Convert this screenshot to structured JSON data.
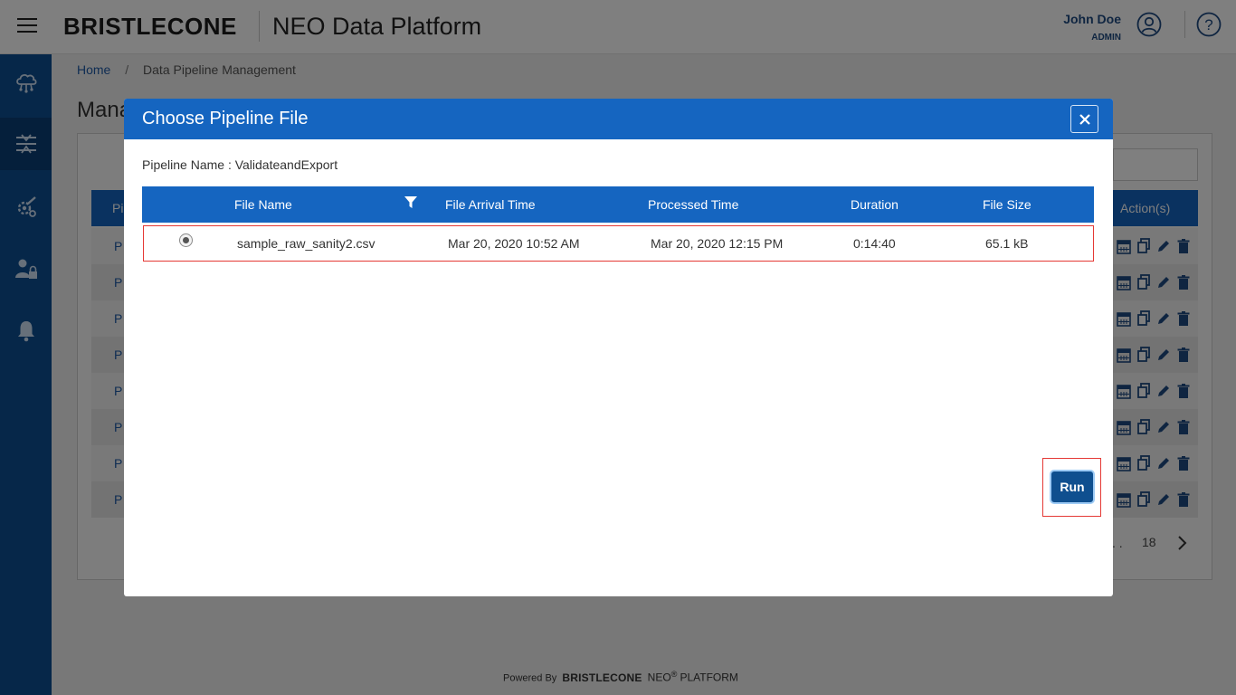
{
  "header": {
    "brand": "BRISTLECONE",
    "app_title": "NEO Data Platform",
    "user_name": "John Doe",
    "user_role": "ADMIN"
  },
  "sidebar": {
    "items": [
      {
        "name": "cloud-network-icon",
        "active": false
      },
      {
        "name": "pipeline-icon",
        "active": true
      },
      {
        "name": "settings-tools-icon",
        "active": false
      },
      {
        "name": "user-admin-icon",
        "active": false
      },
      {
        "name": "bell-icon",
        "active": false
      }
    ]
  },
  "breadcrumb": {
    "home": "Home",
    "separator": "/",
    "current": "Data Pipeline Management"
  },
  "page": {
    "heading": "Mana",
    "table": {
      "col_first": "Pi",
      "col_actions": "Action(s)",
      "row_prefix": "P"
    },
    "pager": {
      "dots": ". .",
      "last_page": "18"
    }
  },
  "footer": {
    "powered_by": "Powered By",
    "brand": "BRISTLECONE",
    "neo": "NEO",
    "reg": "®",
    "platform": "PLATFORM"
  },
  "modal": {
    "title": "Choose Pipeline File",
    "close_label": "×",
    "pipeline_label": "Pipeline Name : ValidateandExport",
    "columns": [
      "File Name",
      "File Arrival Time",
      "Processed Time",
      "Duration",
      "File Size"
    ],
    "rows": [
      {
        "selected": true,
        "file_name": "sample_raw_sanity2.csv",
        "arrival_time": "Mar 20, 2020 10:52 AM",
        "processed_time": "Mar 20, 2020 12:15 PM",
        "duration": "0:14:40",
        "file_size": "65.1 kB"
      }
    ],
    "run_label": "Run"
  },
  "colors": {
    "primary": "#1565c0",
    "sidebar": "#0d4f93",
    "highlight": "#e53935",
    "run_button": "#0f4f8f"
  }
}
